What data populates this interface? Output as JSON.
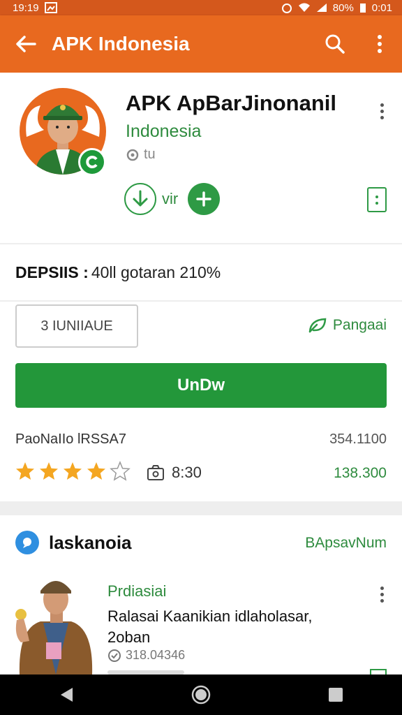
{
  "status_bar": {
    "time_left": "19:19",
    "battery": "80%",
    "time_right": "0:01"
  },
  "app_bar": {
    "title": "APK Indonesia"
  },
  "app": {
    "name": "APK ApBarJinonanil",
    "developer": "Indonesia",
    "meta": "tu",
    "download_text": "vir"
  },
  "deps": {
    "label": "DEPSIIS :",
    "value": "40ll gotaran 210%"
  },
  "actions": {
    "secondary_label": "3 IUNIIAUE",
    "link_label": "Pangaai",
    "primary_label": "UnDw"
  },
  "stats": {
    "rank_label": "PaoNaIIo lRSSA7",
    "rank_value": "354.1100",
    "rating": 4,
    "rating_max": 5,
    "review_count": "8:30",
    "downloads": "138.300"
  },
  "section": {
    "title": "laskanoia",
    "link": "BApsavNum",
    "post": {
      "category": "Prdiasiai",
      "title": "Ralasai Kaanikian idlaholasar, 2oban",
      "views": "318.04346"
    }
  },
  "colors": {
    "accent": "#e8691f",
    "status": "#d4581c",
    "green": "#23973a",
    "link_green": "#2e8b3e",
    "star": "#f4a621",
    "blue": "#2f8fe0"
  }
}
